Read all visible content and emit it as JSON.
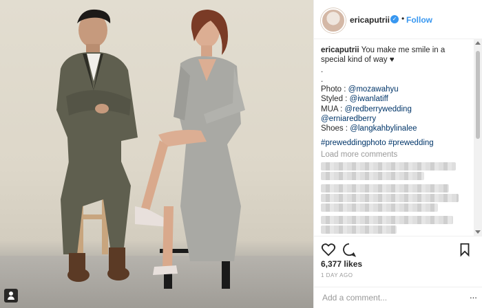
{
  "header": {
    "username": "ericaputrii",
    "follow_label": "Follow"
  },
  "caption": {
    "username": "ericaputrii",
    "text": "You make me smile in a special kind of way ♥",
    "dot1": ".",
    "dot2": ".",
    "credits": [
      {
        "label": "Photo : ",
        "handle": "@mozawahyu"
      },
      {
        "label": "Styled : ",
        "handle": "@iwanlatiff"
      },
      {
        "label": "MUA : ",
        "handle": "@redberrywedding"
      },
      {
        "label": "",
        "handle": "@erniaredberry"
      },
      {
        "label": "Shoes : ",
        "handle": "@langkahbylinalee"
      }
    ],
    "hashtags": "#preweddingphoto #prewedding"
  },
  "load_more": "Load more comments",
  "likes": "6,377 likes",
  "age": "1 DAY AGO",
  "add_comment": {
    "placeholder": "Add a comment...",
    "more": "..."
  },
  "icons": [
    "heart-icon",
    "comment-icon",
    "bookmark-icon",
    "tag-person-icon",
    "verified-icon"
  ],
  "colors": {
    "link": "#003569",
    "follow": "#3897f0",
    "muted": "#999999"
  }
}
